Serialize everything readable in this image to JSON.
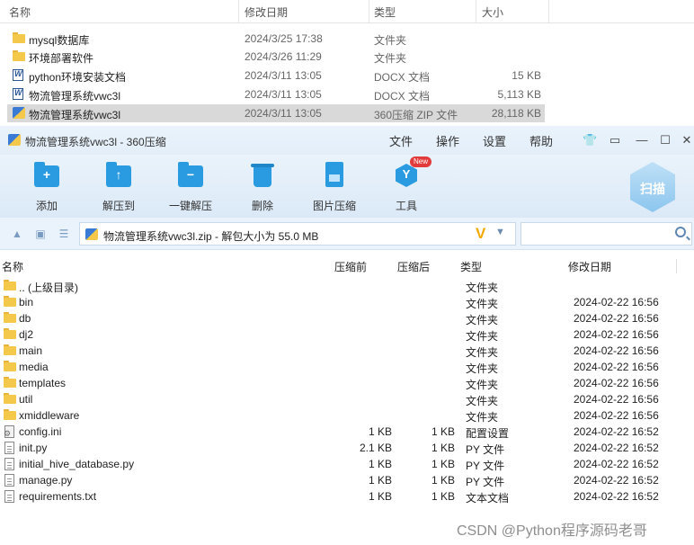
{
  "explorer": {
    "columns": {
      "name": "名称",
      "date": "修改日期",
      "type": "类型",
      "size": "大小"
    },
    "rows": [
      {
        "icon": "folder-icon",
        "name": "mysql数据库",
        "date": "2024/3/25 17:38",
        "type": "文件夹",
        "size": ""
      },
      {
        "icon": "folder-icon",
        "name": "环境部署软件",
        "date": "2024/3/26 11:29",
        "type": "文件夹",
        "size": ""
      },
      {
        "icon": "word-icon",
        "name": "python环境安装文档",
        "date": "2024/3/11 13:05",
        "type": "DOCX 文档",
        "size": "15 KB"
      },
      {
        "icon": "word-icon",
        "name": "物流管理系统vwc3l",
        "date": "2024/3/11 13:05",
        "type": "DOCX 文档",
        "size": "5,113 KB"
      },
      {
        "icon": "zip-icon",
        "name": "物流管理系统vwc3l",
        "date": "2024/3/11 13:05",
        "type": "360压缩 ZIP 文件",
        "size": "28,118 KB"
      }
    ]
  },
  "window": {
    "title": "物流管理系统vwc3l - 360压缩",
    "menu": [
      "文件",
      "操作",
      "设置",
      "帮助"
    ]
  },
  "toolbar": {
    "add": "添加",
    "extract_to": "解压到",
    "one_click": "一键解压",
    "delete": "删除",
    "image_compress": "图片压缩",
    "tools": "工具",
    "new_badge": "New",
    "scan": "扫描"
  },
  "address": {
    "path": "物流管理系统vwc3l.zip - 解包大小为 55.0 MB",
    "search_placeholder": ""
  },
  "zip_list": {
    "columns": {
      "name": "名称",
      "compressed": "压缩前",
      "packed": "压缩后",
      "type": "类型",
      "date": "修改日期"
    },
    "rows": [
      {
        "icon": "folder-icon",
        "name": ".. (上级目录)",
        "compressed": "",
        "packed": "",
        "type": "文件夹",
        "date": ""
      },
      {
        "icon": "folder-icon",
        "name": "bin",
        "compressed": "",
        "packed": "",
        "type": "文件夹",
        "date": "2024-02-22 16:56"
      },
      {
        "icon": "folder-icon",
        "name": "db",
        "compressed": "",
        "packed": "",
        "type": "文件夹",
        "date": "2024-02-22 16:56"
      },
      {
        "icon": "folder-icon",
        "name": "dj2",
        "compressed": "",
        "packed": "",
        "type": "文件夹",
        "date": "2024-02-22 16:56"
      },
      {
        "icon": "folder-icon",
        "name": "main",
        "compressed": "",
        "packed": "",
        "type": "文件夹",
        "date": "2024-02-22 16:56"
      },
      {
        "icon": "folder-icon",
        "name": "media",
        "compressed": "",
        "packed": "",
        "type": "文件夹",
        "date": "2024-02-22 16:56"
      },
      {
        "icon": "folder-icon",
        "name": "templates",
        "compressed": "",
        "packed": "",
        "type": "文件夹",
        "date": "2024-02-22 16:56"
      },
      {
        "icon": "folder-icon",
        "name": "util",
        "compressed": "",
        "packed": "",
        "type": "文件夹",
        "date": "2024-02-22 16:56"
      },
      {
        "icon": "folder-icon",
        "name": "xmiddleware",
        "compressed": "",
        "packed": "",
        "type": "文件夹",
        "date": "2024-02-22 16:56"
      },
      {
        "icon": "cfg-icon",
        "name": "config.ini",
        "compressed": "1 KB",
        "packed": "1 KB",
        "type": "配置设置",
        "date": "2024-02-22 16:52"
      },
      {
        "icon": "file-icon",
        "name": "init.py",
        "compressed": "2.1 KB",
        "packed": "1 KB",
        "type": "PY 文件",
        "date": "2024-02-22 16:52"
      },
      {
        "icon": "file-icon",
        "name": "initial_hive_database.py",
        "compressed": "1 KB",
        "packed": "1 KB",
        "type": "PY 文件",
        "date": "2024-02-22 16:52"
      },
      {
        "icon": "file-icon",
        "name": "manage.py",
        "compressed": "1 KB",
        "packed": "1 KB",
        "type": "PY 文件",
        "date": "2024-02-22 16:52"
      },
      {
        "icon": "file-icon",
        "name": "requirements.txt",
        "compressed": "1 KB",
        "packed": "1 KB",
        "type": "文本文档",
        "date": "2024-02-22 16:52"
      }
    ]
  },
  "watermark": "CSDN @Python程序源码老哥",
  "colors": {
    "accent": "#2a9be0",
    "selection": "#d9d9d9",
    "folder": "#f4c84a",
    "new_badge": "#e23b3b"
  }
}
